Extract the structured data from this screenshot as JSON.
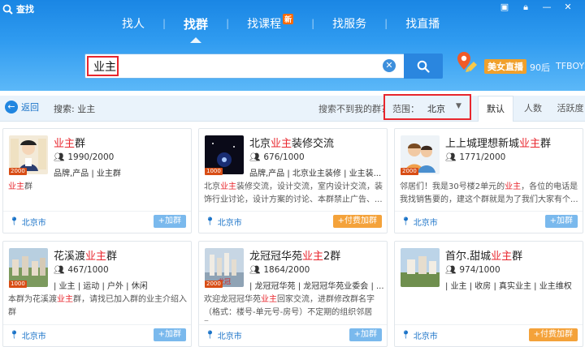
{
  "app": {
    "title": "查找"
  },
  "nav": {
    "tabs": [
      {
        "label": "找人"
      },
      {
        "label": "找群"
      },
      {
        "label": "找课程"
      },
      {
        "label": "找服务"
      },
      {
        "label": "找直播"
      }
    ],
    "new_badge": "新"
  },
  "search": {
    "value": "业主"
  },
  "quick_tags": [
    "美女直播",
    "90后",
    "TFBOYS"
  ],
  "filter": {
    "back": "返回",
    "keyword_text": "搜索: 业主",
    "not_found": "搜索不到我的群？",
    "range_label": "范围：",
    "range_value": "北京",
    "sort": [
      "默认",
      "人数",
      "活跃度"
    ]
  },
  "groups": [
    {
      "name_pre": "",
      "name_hl": "业主",
      "name_post": "群",
      "count": "1990/2000",
      "tags": "品牌,产品 | 业主群",
      "desc_pre": "",
      "desc_hl": "业主",
      "desc_post": "群",
      "level": "2000",
      "location": "北京市",
      "join": "+加群",
      "join_type": "free"
    },
    {
      "name_pre": "北京",
      "name_hl": "业主",
      "name_post": "装修交流",
      "count": "676/1000",
      "tags": "品牌,产品 | 北京业主装修 | 业主装...",
      "desc_pre": "北京",
      "desc_hl": "业主",
      "desc_post": "装修交流，设计交流，室内设计交流，装饰行业讨论，设计方案的讨论、本群禁止广告、...",
      "level": "1000",
      "location": "北京市",
      "join": "+付费加群",
      "join_type": "paid"
    },
    {
      "name_pre": "上上城理想新城",
      "name_hl": "业主",
      "name_post": "群",
      "count": "1771/2000",
      "tags": "",
      "desc_pre": "邻居们！我是30号楼2单元的",
      "desc_hl": "业主",
      "desc_post": "，各位的电话是我找销售要的，建这个群就是为了我们大家有个...",
      "level": "2000",
      "location": "北京市",
      "join": "+加群",
      "join_type": "free"
    },
    {
      "name_pre": "花溪渡",
      "name_hl": "业主",
      "name_post": "群",
      "count": "467/1000",
      "tags": "| 业主 | 运动 | 户外 | 休闲",
      "desc_pre": "本群为花溪渡",
      "desc_hl": "业主",
      "desc_post": "群，请找已加入群的业主介绍入群",
      "level": "1000",
      "location": "北京市",
      "join": "+加群",
      "join_type": "free"
    },
    {
      "name_pre": "龙冠冠华苑",
      "name_hl": "业主",
      "name_post": "2群",
      "count": "1864/2000",
      "tags": "| 龙冠冠华苑 | 龙冠冠华苑业委会 | ...",
      "desc_pre": "欢迎龙冠冠华苑",
      "desc_hl": "业主",
      "desc_post": "回家交流，进群修改群名字（格式：楼号-单元号-房号）不定期的组织邻居聚...",
      "level": "2000",
      "location": "北京市",
      "join": "+加群",
      "join_type": "free"
    },
    {
      "name_pre": "首尔.甜城",
      "name_hl": "业主",
      "name_post": "群",
      "count": "974/1000",
      "tags": "| 业主 | 收房 | 真实业主 | 业主维权",
      "desc_pre": "",
      "desc_hl": "",
      "desc_post": "",
      "level": "",
      "location": "北京市",
      "join": "+付费加群",
      "join_type": "paid"
    }
  ],
  "colors": {
    "header": "#2f9bf0",
    "accent": "#2a86df",
    "highlight": "#e8262d",
    "paid": "#f4a23a",
    "free": "#7ab9ed"
  }
}
